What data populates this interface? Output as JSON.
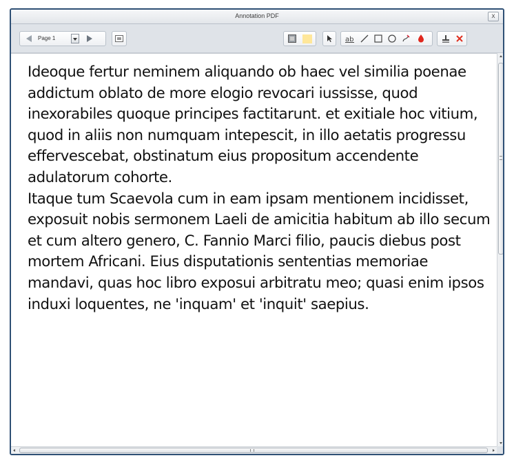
{
  "window": {
    "title": "Annotation PDF",
    "close_label": "x"
  },
  "toolbar": {
    "page_select_value": "Page 1",
    "tools": [
      {
        "name": "prev-page",
        "icon": "triangle-left-icon"
      },
      {
        "name": "page-select",
        "icon": "chevron-down-icon"
      },
      {
        "name": "next-page",
        "icon": "triangle-right-icon"
      },
      {
        "name": "fit-page",
        "icon": "page-fit-icon"
      },
      {
        "name": "border-color",
        "icon": "square-gray-icon"
      },
      {
        "name": "fill-color",
        "icon": "square-yellow-icon"
      },
      {
        "name": "select",
        "icon": "cursor-arrow-icon"
      },
      {
        "name": "text",
        "icon": "text-annotation-icon"
      },
      {
        "name": "line",
        "icon": "line-icon"
      },
      {
        "name": "rectangle",
        "icon": "rectangle-icon"
      },
      {
        "name": "ellipse",
        "icon": "ellipse-icon"
      },
      {
        "name": "pencil",
        "icon": "pencil-icon"
      },
      {
        "name": "ink-color",
        "icon": "droplet-icon"
      },
      {
        "name": "stamp",
        "icon": "stamp-icon"
      },
      {
        "name": "delete",
        "icon": "red-x-icon"
      }
    ],
    "colors": {
      "fill_swatch": "#ffe79a",
      "delete": "#e03020",
      "droplet": "#e0281e"
    }
  },
  "document": {
    "paragraphs": [
      "Ideoque fertur neminem aliquando ob haec vel similia poenae addictum oblato de more elogio revocari iussisse, quod inexorabiles quoque principes factitarunt. et exitiale hoc vitium, quod in aliis non numquam intepescit, in illo aetatis progressu effervescebat, obstinatum eius propositum accendente adulatorum cohorte.",
      "Itaque tum Scaevola cum in eam ipsam mentionem incidisset, exposuit nobis sermonem Laeli de amicitia habitum ab illo secum et cum altero genero, C. Fannio Marci filio, paucis diebus post mortem Africani. Eius disputationis sententias memoriae mandavi, quas hoc libro exposui arbitratu meo; quasi enim ipsos induxi loquentes, ne 'inquam' et 'inquit' saepius."
    ]
  }
}
